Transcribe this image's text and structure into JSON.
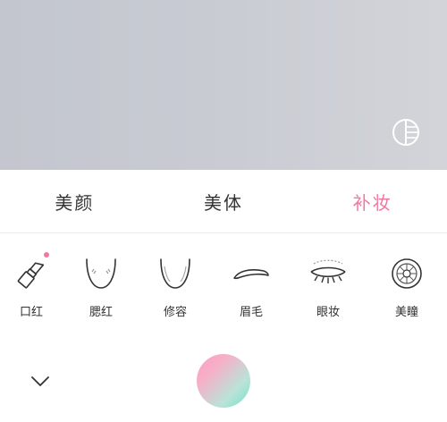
{
  "tabs": [
    {
      "label": "美颜",
      "active": false
    },
    {
      "label": "美体",
      "active": false
    },
    {
      "label": "补妆",
      "active": true
    }
  ],
  "tools": [
    {
      "label": "口红",
      "icon": "lipstick-icon",
      "has_indicator": true
    },
    {
      "label": "腮红",
      "icon": "blush-icon"
    },
    {
      "label": "修容",
      "icon": "contour-icon"
    },
    {
      "label": "眉毛",
      "icon": "eyebrow-icon"
    },
    {
      "label": "眼妆",
      "icon": "eye-makeup-icon"
    },
    {
      "label": "美瞳",
      "icon": "contact-lens-icon"
    }
  ],
  "icons": {
    "compare": "compare-icon",
    "collapse": "chevron-down-icon"
  },
  "colors": {
    "accent": "#f0789e",
    "text": "#333333",
    "preview_bg": "#c8cbd2"
  }
}
